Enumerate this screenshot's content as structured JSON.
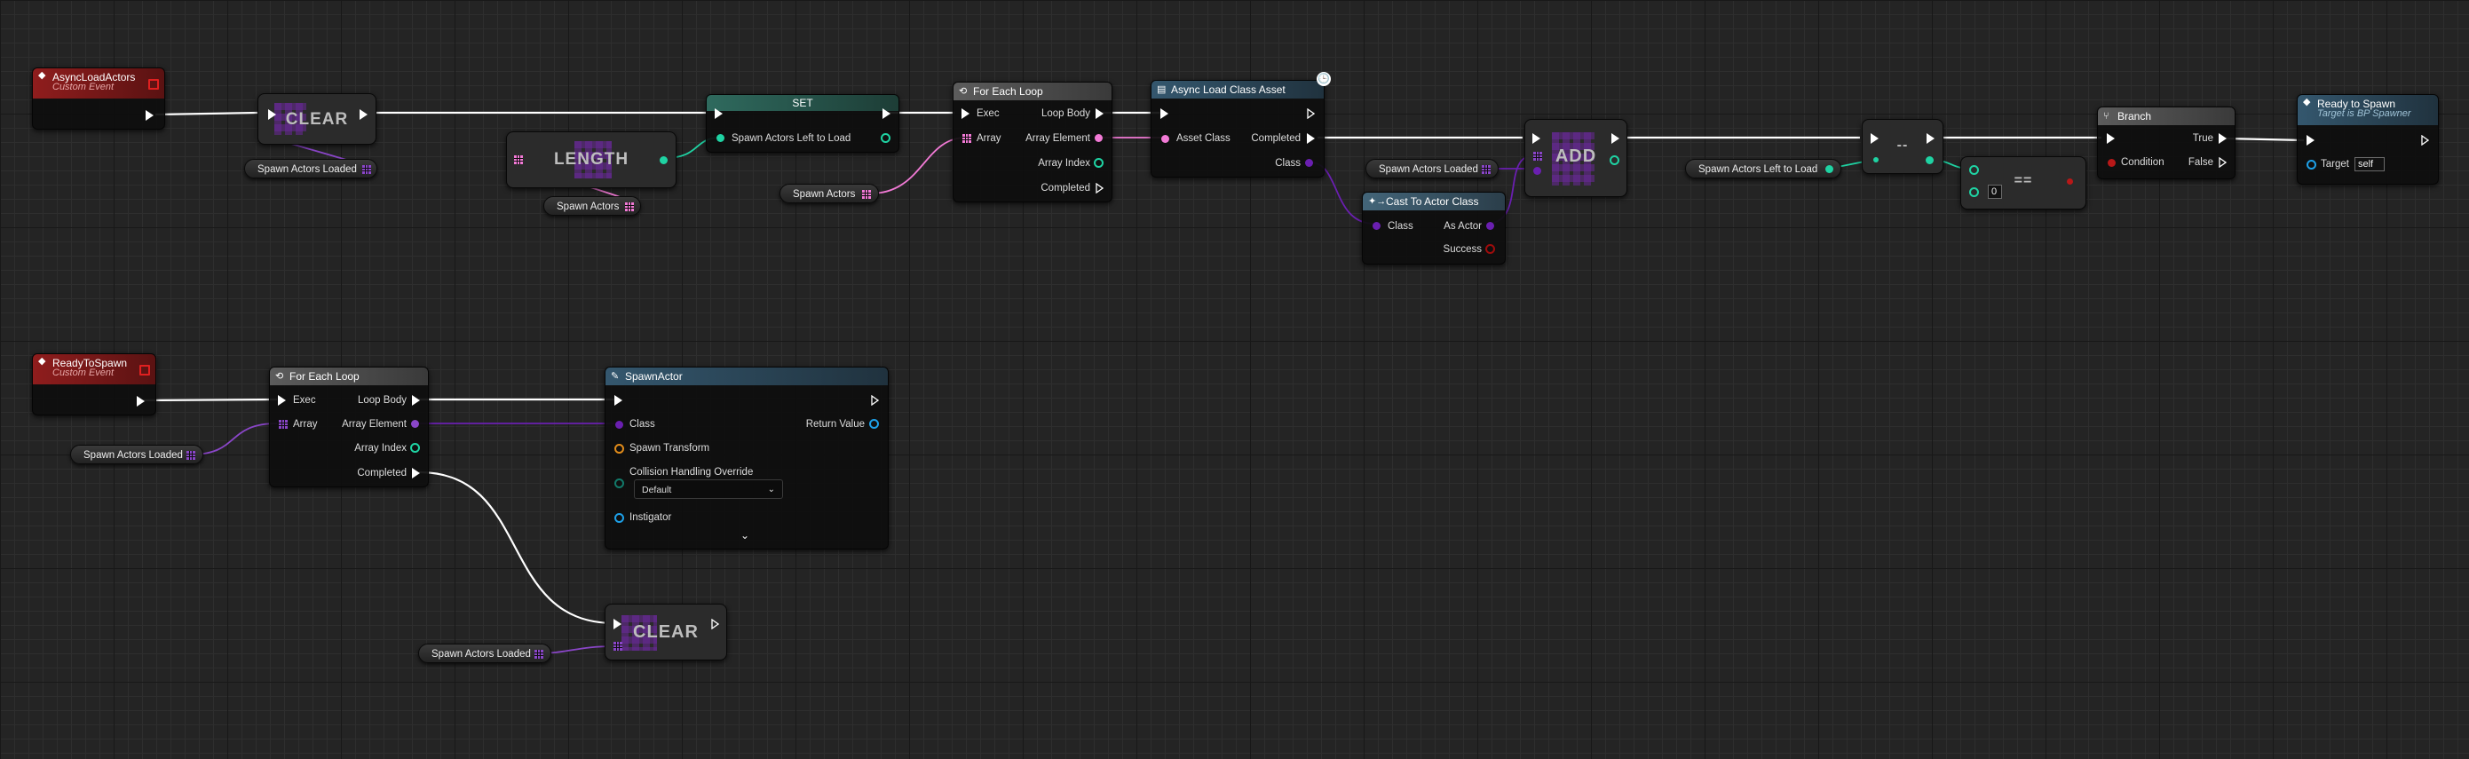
{
  "colors": {
    "exec": "#ffffff",
    "object_pin": "#8a46c8",
    "int_pin": "#1fd3a3",
    "class_pin": "#6a1fb0",
    "soft_class_pin": "#f27ad6",
    "bool_pin": "#9e0c0c",
    "struct_pin": "#e08b1a",
    "instigator_pin": "#1ea0e8",
    "event_header": "#8f1d1d"
  },
  "icons": {
    "event": "event-diamond-icon",
    "loop": "loop-arrows-icon",
    "function": "function-f-icon",
    "branch": "branch-icon",
    "latent": "clock-icon",
    "array": "array-grid-icon"
  },
  "events": {
    "async_load_actors": {
      "title": "AsyncLoadActors",
      "subtitle": "Custom Event"
    },
    "ready_to_spawn": {
      "title": "ReadyToSpawn",
      "subtitle": "Custom Event"
    }
  },
  "nodes": {
    "clear_top": {
      "label": "CLEAR"
    },
    "length": {
      "label": "LENGTH"
    },
    "set": {
      "label": "SET",
      "pin": "Spawn Actors Left to Load"
    },
    "for_each_1": {
      "title": "For Each Loop",
      "pins_in": [
        "Exec",
        "Array"
      ],
      "pins_out": [
        "Loop Body",
        "Array Element",
        "Array Index",
        "Completed"
      ]
    },
    "async_load_class": {
      "title": "Async Load Class Asset",
      "pins_in": [
        "Asset Class"
      ],
      "pins_out": [
        "Completed",
        "Class"
      ]
    },
    "cast": {
      "title": "Cast To Actor Class",
      "pin_in": "Class",
      "pins_out": [
        "As Actor",
        "Success"
      ]
    },
    "add": {
      "label": "ADD"
    },
    "equal": {
      "label": "==",
      "value": "0"
    },
    "minus": {
      "label": "--"
    },
    "branch": {
      "title": "Branch",
      "pin_in": "Condition",
      "pins_out": [
        "True",
        "False"
      ]
    },
    "ready_call": {
      "title": "Ready to Spawn",
      "subtitle": "Target is BP Spawner",
      "pin_label": "Target",
      "target_value": "self"
    },
    "for_each_2": {
      "title": "For Each Loop",
      "pins_in": [
        "Exec",
        "Array"
      ],
      "pins_out": [
        "Loop Body",
        "Array Element",
        "Array Index",
        "Completed"
      ]
    },
    "spawn_actor": {
      "title": "SpawnActor",
      "pins": [
        "Class",
        "Spawn Transform",
        "Collision Handling Override",
        "Instigator"
      ],
      "return": "Return Value",
      "dropdown": "Default"
    },
    "clear_bottom": {
      "label": "CLEAR"
    }
  },
  "variables": {
    "spawn_actors_loaded": "Spawn Actors Loaded",
    "spawn_actors": "Spawn Actors",
    "spawn_actors_left_to_load": "Spawn Actors Left to Load"
  }
}
